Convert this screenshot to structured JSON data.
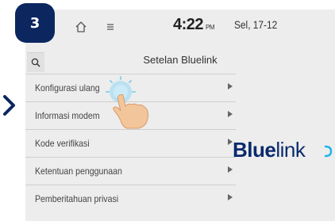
{
  "step": {
    "number": "3"
  },
  "status_bar": {
    "time": "4:22",
    "ampm": "PM",
    "date": "Sel, 17-12",
    "icons": [
      "home-icon",
      "menu-icon"
    ]
  },
  "header": {
    "title": "Setelan Bluelink",
    "search_icon": "search-icon"
  },
  "settings_list": {
    "items": [
      {
        "label": "Konfigurasi ulang",
        "icon": "chevron-right-icon"
      },
      {
        "label": "Informasi modem",
        "icon": "chevron-right-icon"
      },
      {
        "label": "Kode verifikasi",
        "icon": "chevron-right-icon"
      },
      {
        "label": "Ketentuan penggunaan",
        "icon": "chevron-right-icon"
      },
      {
        "label": "Pemberitahuan privasi",
        "icon": "chevron-right-icon"
      }
    ]
  },
  "brand": {
    "part1": "Blue",
    "part2": "link"
  },
  "colors": {
    "badge": "#0c2660",
    "screen_bg": "#ededed",
    "brand": "#0a2a6e",
    "tap_highlight": "#8fd0ee"
  }
}
